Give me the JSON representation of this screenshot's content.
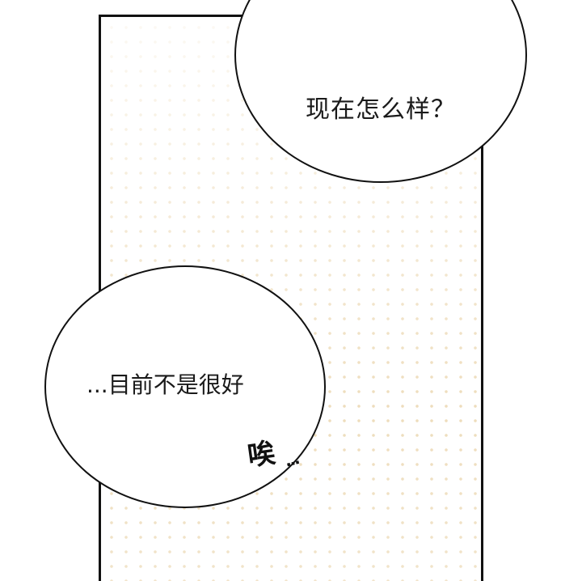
{
  "dialogue": {
    "top_bubble": "现在怎么样？",
    "bottom_bubble": "...目前不是很好"
  },
  "sound_effect": {
    "text": "唉",
    "trail": "..."
  },
  "colors": {
    "ink": "#111111",
    "screentone": "#ecd9b4",
    "background": "#ffffff"
  }
}
